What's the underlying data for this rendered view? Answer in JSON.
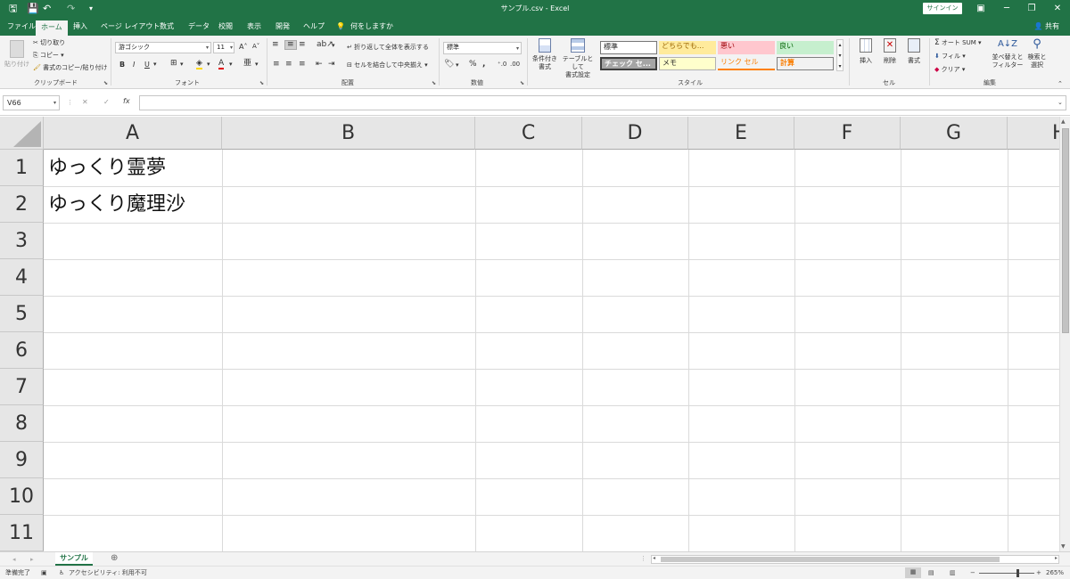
{
  "window": {
    "title": "サンプル.csv  -  Excel",
    "signin_label": "サインイン",
    "share_label": "共有"
  },
  "tabs": [
    "ファイル",
    "ホーム",
    "挿入",
    "ページ レイアウト",
    "数式",
    "データ",
    "校閲",
    "表示",
    "開発",
    "ヘルプ"
  ],
  "active_tab": "ホーム",
  "tell_me": "何をしますか",
  "ribbon": {
    "clipboard": {
      "paste": "貼り付け",
      "cut": "切り取り",
      "copy": "コピー",
      "format_painter": "書式のコピー/貼り付け",
      "group": "クリップボード"
    },
    "font": {
      "name": "游ゴシック",
      "size": "11",
      "group": "フォント"
    },
    "alignment": {
      "wrap": "折り返して全体を表示する",
      "merge": "セルを結合して中央揃え",
      "group": "配置"
    },
    "number": {
      "format": "標準",
      "group": "数値"
    },
    "styles": {
      "conditional": "条件付き",
      "conditional2": "書式",
      "table": "テーブルとして",
      "table2": "書式設定",
      "items": [
        "標準",
        "どちらでも...",
        "悪い",
        "良い",
        "チェック セ...",
        "メモ",
        "リンク セル",
        "計算"
      ],
      "group": "スタイル"
    },
    "cells": {
      "insert": "挿入",
      "delete": "削除",
      "format": "書式",
      "group": "セル"
    },
    "editing": {
      "autosum": "オート SUM",
      "fill": "フィル",
      "clear": "クリア",
      "sort": "並べ替えと",
      "sort2": "フィルター",
      "find": "検索と",
      "find2": "選択",
      "group": "編集"
    }
  },
  "formula_bar": {
    "name_box": "V66",
    "fx": "fx",
    "formula": ""
  },
  "columns": [
    "A",
    "B",
    "C",
    "D",
    "E",
    "F",
    "G",
    "H"
  ],
  "rows": [
    "1",
    "2",
    "3",
    "4",
    "5",
    "6",
    "7",
    "8",
    "9",
    "10",
    "11"
  ],
  "cells": {
    "A1": "ゆっくり霊夢",
    "A2": "ゆっくり魔理沙"
  },
  "sheets": [
    "サンプル"
  ],
  "status": {
    "ready": "準備完了",
    "accessibility": "アクセシビリティ: 利用不可",
    "zoom": "265%"
  }
}
